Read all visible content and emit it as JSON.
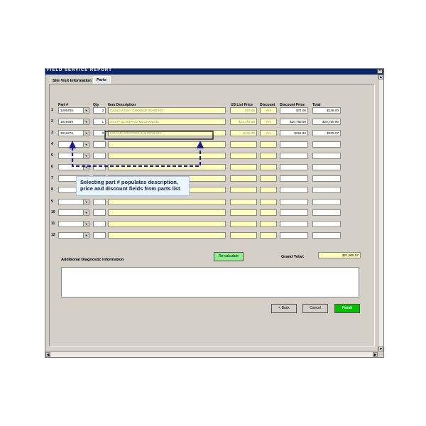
{
  "window": {
    "title": "FIELD SERVICE REPORT",
    "close": "×"
  },
  "tabs": [
    {
      "label": "Site Visit Information"
    },
    {
      "label": "Parts"
    }
  ],
  "columns": {
    "part": "Part #",
    "qty": "Qty",
    "desc": "Item Description",
    "list": "US List Price",
    "disc": "Discount",
    "dprice": "Discount Price",
    "total": "Total"
  },
  "rows": [
    {
      "num": "1",
      "part": "1006765",
      "qty": "2",
      "desc": "CABLE ASSY* GROUND BONDING",
      "list": "$74.00",
      "disc": "Yes",
      "dprice": "$74.00",
      "total": "$148.00"
    },
    {
      "num": "2",
      "part": "1019388",
      "qty": "1",
      "desc": "ASSY* CLAMPING MECHANISM",
      "list": "$24,454.00",
      "disc": "Yes",
      "dprice": "$20,785.90",
      "total": "$20,785.90"
    },
    {
      "num": "3",
      "part": "1019278",
      "qty": "3",
      "desc": "MOTOR* STEPPER 6H4JXPD 901",
      "list": "$440.75",
      "disc": "Yes",
      "dprice": "$291.69",
      "total": "$875.07"
    },
    {
      "num": "4"
    },
    {
      "num": "5"
    },
    {
      "num": "6"
    },
    {
      "num": "7"
    },
    {
      "num": "8"
    },
    {
      "num": "9"
    },
    {
      "num": "10"
    },
    {
      "num": "11"
    },
    {
      "num": "12"
    }
  ],
  "callout": "Selecting part # populates description, price and discount fields from parts list",
  "grand_total_label": "Grand Total:",
  "grand_total": "$21,808.97",
  "recalc_label": "Re-calculate",
  "diag_label": "Additional Diagnostic Information",
  "back_label": "< Back",
  "cancel_label": "Cancel",
  "finish_label": "Finish",
  "colors": {
    "title_bar": "#0a246a",
    "field_yellow": "#ffffc0",
    "finish_green": "#00c000",
    "annotation": "#1c1c8c"
  }
}
